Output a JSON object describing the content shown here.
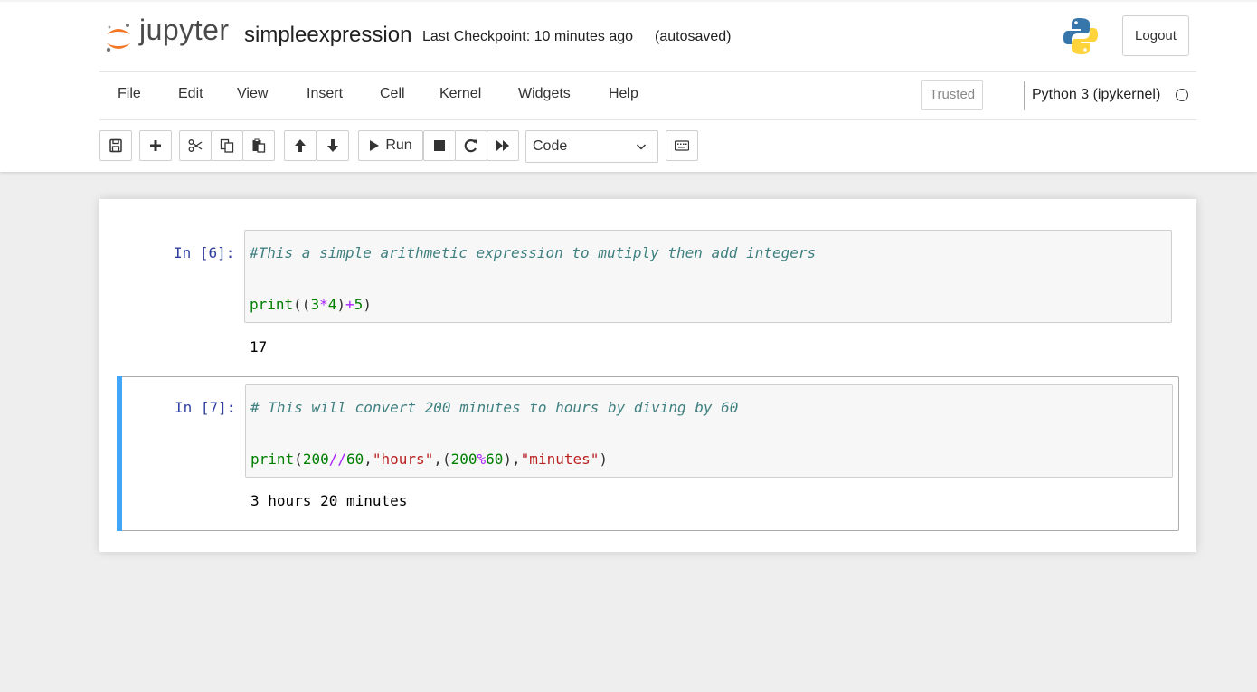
{
  "header": {
    "logo_text": "jupyter",
    "notebook_name": "simpleexpression",
    "checkpoint": "Last Checkpoint: 10 minutes ago",
    "autosave_status": "(autosaved)",
    "logout_label": "Logout"
  },
  "menubar": {
    "items": [
      "File",
      "Edit",
      "View",
      "Insert",
      "Cell",
      "Kernel",
      "Widgets",
      "Help"
    ],
    "trusted_label": "Trusted",
    "kernel_name": "Python 3 (ipykernel)"
  },
  "toolbar": {
    "buttons": [
      "save-icon",
      "plus-icon",
      "scissors-icon",
      "copy-icon",
      "paste-icon",
      "arrow-up-icon",
      "arrow-down-icon",
      "run-icon",
      "stop-icon",
      "restart-icon",
      "fast-forward-icon",
      "keyboard-icon"
    ],
    "run_label": "Run",
    "cell_type": "Code"
  },
  "cells": [
    {
      "prompt": "In [6]:",
      "comment": "#This a simple arithmetic expression to mutiply then add integers",
      "code_tokens": [
        {
          "t": "print",
          "c": "builtin"
        },
        {
          "t": "((",
          "c": "plain"
        },
        {
          "t": "3",
          "c": "num"
        },
        {
          "t": "*",
          "c": "op"
        },
        {
          "t": "4",
          "c": "num"
        },
        {
          "t": ")",
          "c": "plain"
        },
        {
          "t": "+",
          "c": "op"
        },
        {
          "t": "5",
          "c": "num"
        },
        {
          "t": ")",
          "c": "plain"
        }
      ],
      "output": "17"
    },
    {
      "prompt": "In [7]:",
      "comment": "# This will convert 200 minutes to hours by diving by 60",
      "code_tokens": [
        {
          "t": "print",
          "c": "builtin"
        },
        {
          "t": "(",
          "c": "plain"
        },
        {
          "t": "200",
          "c": "num"
        },
        {
          "t": "//",
          "c": "op"
        },
        {
          "t": "60",
          "c": "num"
        },
        {
          "t": ",",
          "c": "plain"
        },
        {
          "t": "\"hours\"",
          "c": "str"
        },
        {
          "t": ",(",
          "c": "plain"
        },
        {
          "t": "200",
          "c": "num"
        },
        {
          "t": "%",
          "c": "op"
        },
        {
          "t": "60",
          "c": "num"
        },
        {
          "t": "),",
          "c": "plain"
        },
        {
          "t": "\"minutes\"",
          "c": "str"
        },
        {
          "t": ")",
          "c": "plain"
        }
      ],
      "output": "3 hours 20 minutes"
    }
  ],
  "colors": {
    "prompt": "#303f9f",
    "comment": "#408080",
    "builtin": "#008000",
    "operator": "#aa22ff",
    "string": "#ba2121",
    "selected_cell_bar": "#42a5f5",
    "logo_orange": "#f37726"
  }
}
